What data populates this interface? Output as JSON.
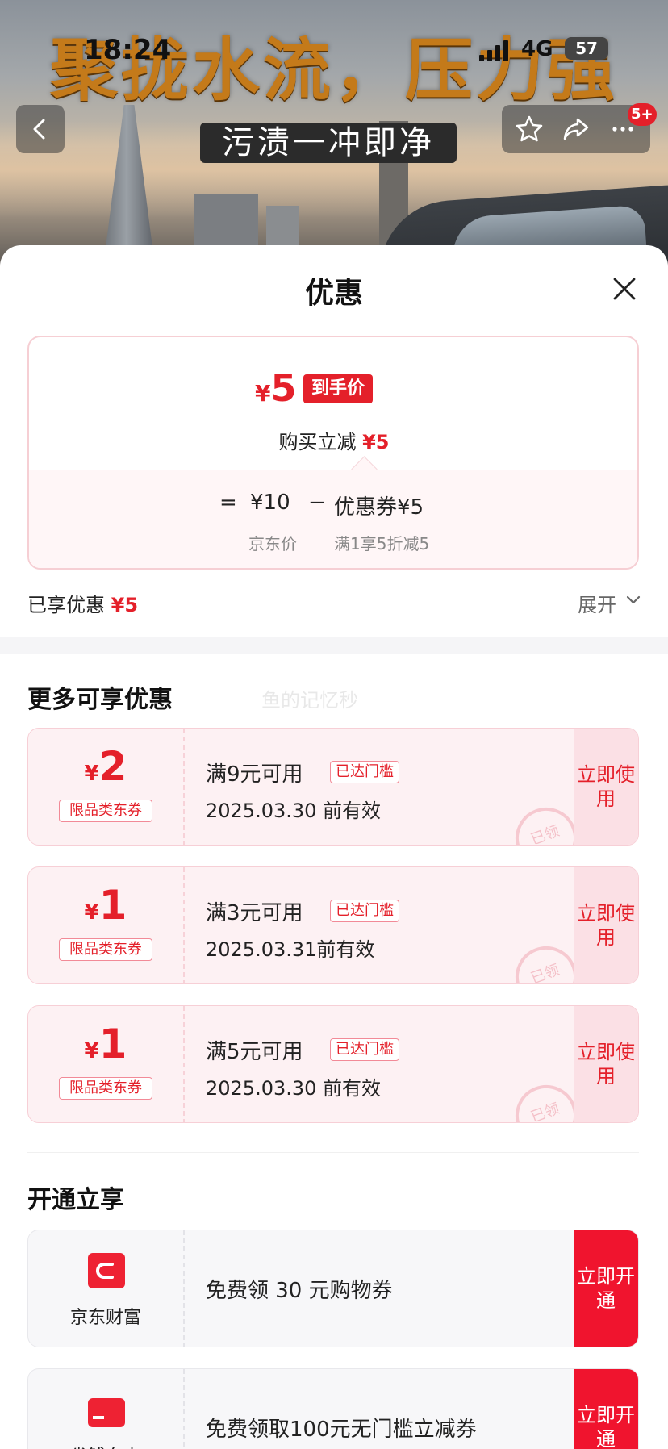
{
  "status_bar": {
    "time": "18:24",
    "network": "4G",
    "battery": "57"
  },
  "banner": {
    "headline": "聚拢水流，压力强",
    "subline": "污渍一冲即净",
    "badge": "5+"
  },
  "sheet": {
    "title": "优惠",
    "summary": {
      "final_price": "5",
      "currency": "¥",
      "final_tag": "到手价",
      "instant_label": "购买立减",
      "instant_value": "¥5",
      "calc_eq": "=",
      "jd_price": "¥10",
      "calc_minus": "−",
      "coupon_part": "优惠券¥5",
      "jd_price_label": "京东价",
      "coupon_rule": "满1享5折减5"
    },
    "enjoyed_label": "已享优惠",
    "enjoyed_value": "¥5",
    "expand_label": "展开",
    "more_title": "更多可享优惠",
    "watermark": "鱼的记忆秒",
    "coupons": [
      {
        "amount": "2",
        "type": "限品类东券",
        "condition": "满9元可用",
        "reached": "已达门槛",
        "valid": "2025.03.30 前有效",
        "use": "立即使用",
        "stamp": "已领"
      },
      {
        "amount": "1",
        "type": "限品类东券",
        "condition": "满3元可用",
        "reached": "已达门槛",
        "valid": "2025.03.31前有效",
        "use": "立即使用",
        "stamp": "已领"
      },
      {
        "amount": "1",
        "type": "限品类东券",
        "condition": "满5元可用",
        "reached": "已达门槛",
        "valid": "2025.03.30 前有效",
        "use": "立即使用",
        "stamp": "已领"
      }
    ],
    "open_title": "开通立享",
    "open_items": [
      {
        "name": "京东财富",
        "text": "免费领 30 元购物券",
        "button": "立即开通"
      },
      {
        "name": "省钱东卡",
        "text": "免费领取100元无门槛立减券",
        "button": "立即开通"
      }
    ]
  },
  "colors": {
    "accent": "#e4202a",
    "coupon_bg": "#fdf1f3"
  }
}
